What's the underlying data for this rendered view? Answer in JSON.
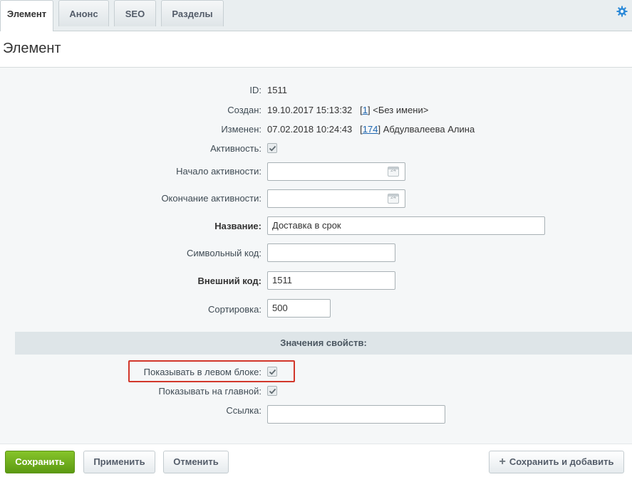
{
  "tabs": [
    {
      "label": "Элемент",
      "active": true
    },
    {
      "label": "Анонс",
      "active": false
    },
    {
      "label": "SEO",
      "active": false
    },
    {
      "label": "Разделы",
      "active": false
    }
  ],
  "page_title": "Элемент",
  "fields": {
    "id": {
      "label": "ID:",
      "value": "1511"
    },
    "created": {
      "label": "Создан:",
      "date": "19.10.2017 15:13:32",
      "open": "[",
      "user_id": "1",
      "close": "]",
      "user_name": "<Без имени>"
    },
    "modified": {
      "label": "Изменен:",
      "date": "07.02.2018 10:24:43",
      "open": "[",
      "user_id": "174",
      "close": "]",
      "user_name": "Абдулвалеева Алина"
    },
    "active": {
      "label": "Активность:",
      "checked": true
    },
    "active_from": {
      "label": "Начало активности:",
      "value": "",
      "calendar_day": "24"
    },
    "active_to": {
      "label": "Окончание активности:",
      "value": "",
      "calendar_day": "24"
    },
    "name": {
      "label": "Название:",
      "value": "Доставка в срок"
    },
    "code": {
      "label": "Символьный код:",
      "value": ""
    },
    "external_code": {
      "label": "Внешний код:",
      "value": "1511"
    },
    "sort": {
      "label": "Сортировка:",
      "value": "500"
    }
  },
  "properties_section": {
    "title": "Значения свойств:",
    "show_left": {
      "label": "Показывать в левом блоке:",
      "checked": true
    },
    "show_main": {
      "label": "Показывать на главной:",
      "checked": true
    },
    "link": {
      "label": "Ссылка:",
      "value": ""
    }
  },
  "buttons": {
    "save": "Сохранить",
    "apply": "Применить",
    "cancel": "Отменить",
    "save_add": "Сохранить и добавить"
  },
  "colors": {
    "primary_button": "#6aad1a",
    "highlight_border": "#d2372b",
    "link": "#2067b0"
  }
}
